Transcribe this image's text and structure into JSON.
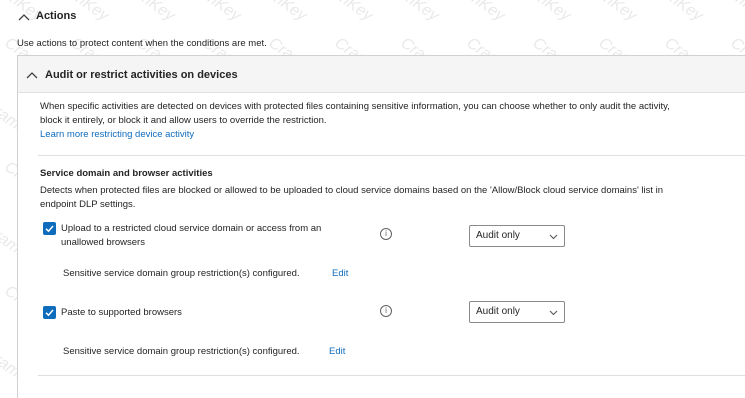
{
  "actions": {
    "title": "Actions",
    "description": "Use actions to protect content when the conditions are met."
  },
  "panel": {
    "title": "Audit or restrict activities on devices",
    "description_line1": "When specific activities are detected on devices with protected files containing sensitive information, you can choose whether to only audit the activity,",
    "description_line2": "block it entirely, or block it and allow users to override the restriction.",
    "learn_more": "Learn more restricting device activity"
  },
  "service_domain": {
    "title": "Service domain and browser activities",
    "description_line1": "Detects when protected files are blocked or allowed to be uploaded to cloud service domains based on the 'Allow/Block cloud service domains' list in",
    "description_line2": "endpoint DLP settings.",
    "items": [
      {
        "label_line1": "Upload to a restricted cloud service domain or access from an",
        "label_line2": "unallowed browsers",
        "checked": true,
        "info_icon": "info-icon",
        "dropdown_value": "Audit only",
        "restriction_text": "Sensitive service domain group restriction(s) configured.",
        "edit_label": "Edit"
      },
      {
        "label_line1": "Paste to supported browsers",
        "checked": true,
        "info_icon": "info-icon",
        "dropdown_value": "Audit only",
        "restriction_text": "Sensitive service domain group restriction(s) configured.",
        "edit_label": "Edit"
      }
    ]
  },
  "watermark": "CramKey",
  "colors": {
    "accent": "#0f6cbd",
    "text": "#242424",
    "header_bg": "#f5f5f5",
    "border": "#d1d1d1"
  }
}
